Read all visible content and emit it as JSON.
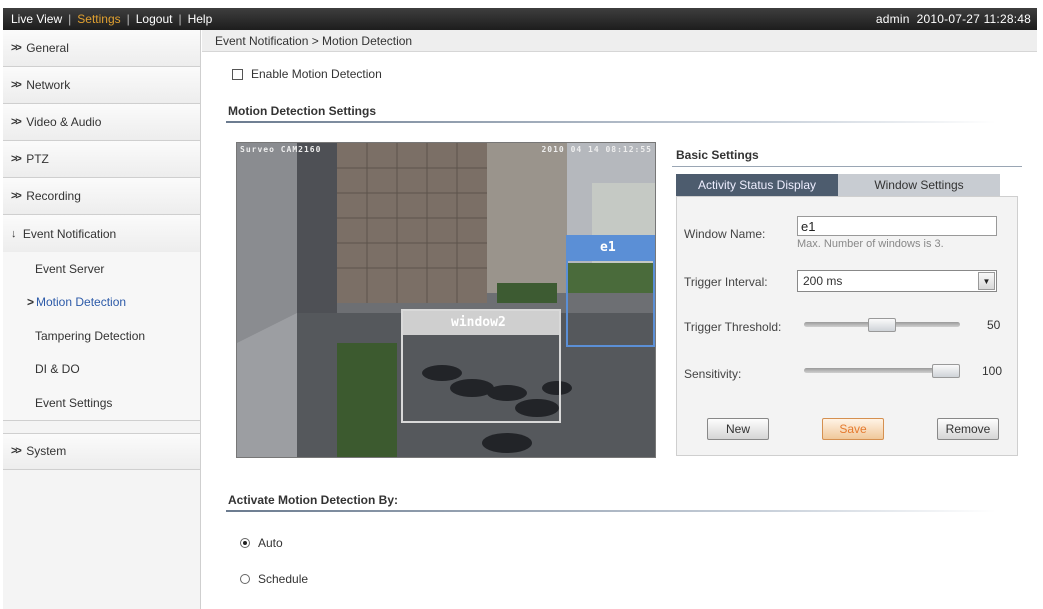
{
  "topbar": {
    "nav": [
      {
        "label": "Live View",
        "active": false
      },
      {
        "label": "Settings",
        "active": true
      },
      {
        "label": "Logout",
        "active": false
      },
      {
        "label": "Help",
        "active": false
      }
    ],
    "user": "admin",
    "datetime": "2010-07-27 11:28:48"
  },
  "sidebar": {
    "items": [
      {
        "label": "General"
      },
      {
        "label": "Network"
      },
      {
        "label": "Video & Audio"
      },
      {
        "label": "PTZ"
      },
      {
        "label": "Recording"
      },
      {
        "label": "Event Notification"
      },
      {
        "label": "System"
      }
    ],
    "event_sub": [
      {
        "label": "Event Server"
      },
      {
        "label": "Motion Detection",
        "active": true
      },
      {
        "label": "Tampering Detection"
      },
      {
        "label": "DI & DO"
      },
      {
        "label": "Event Settings"
      }
    ]
  },
  "breadcrumb": "Event Notification > Motion Detection",
  "enable_motion": {
    "label": "Enable Motion Detection",
    "checked": false
  },
  "motion_settings_title": "Motion Detection Settings",
  "camera": {
    "osd_left": "Surveo CAM2160",
    "osd_right": "2010 04 14 08:12:55",
    "windows": [
      {
        "name": "e1",
        "color": "#5b8fd6"
      },
      {
        "name": "window2",
        "color": "#d9d9d9"
      }
    ]
  },
  "basic": {
    "title": "Basic Settings",
    "tabs": [
      {
        "label": "Activity Status Display",
        "active": true
      },
      {
        "label": "Window Settings",
        "active": false
      }
    ],
    "window_name_label": "Window Name:",
    "window_name_value": "e1",
    "window_hint": "Max. Number of windows is 3.",
    "trigger_interval_label": "Trigger Interval:",
    "trigger_interval_value": "200 ms",
    "trigger_threshold_label": "Trigger Threshold:",
    "trigger_threshold_value": "50",
    "trigger_threshold_fraction": 0.5,
    "sensitivity_label": "Sensitivity:",
    "sensitivity_value": "100",
    "sensitivity_fraction": 1.0,
    "buttons": {
      "new": "New",
      "save": "Save",
      "remove": "Remove"
    }
  },
  "activate": {
    "title": "Activate Motion Detection By:",
    "options": [
      {
        "label": "Auto",
        "checked": true
      },
      {
        "label": "Schedule",
        "checked": false
      }
    ]
  },
  "colors": {
    "accent_active_nav": "#e0a030",
    "active_sub": "#2c5aa8",
    "tab_active": "#4d5c6e"
  }
}
